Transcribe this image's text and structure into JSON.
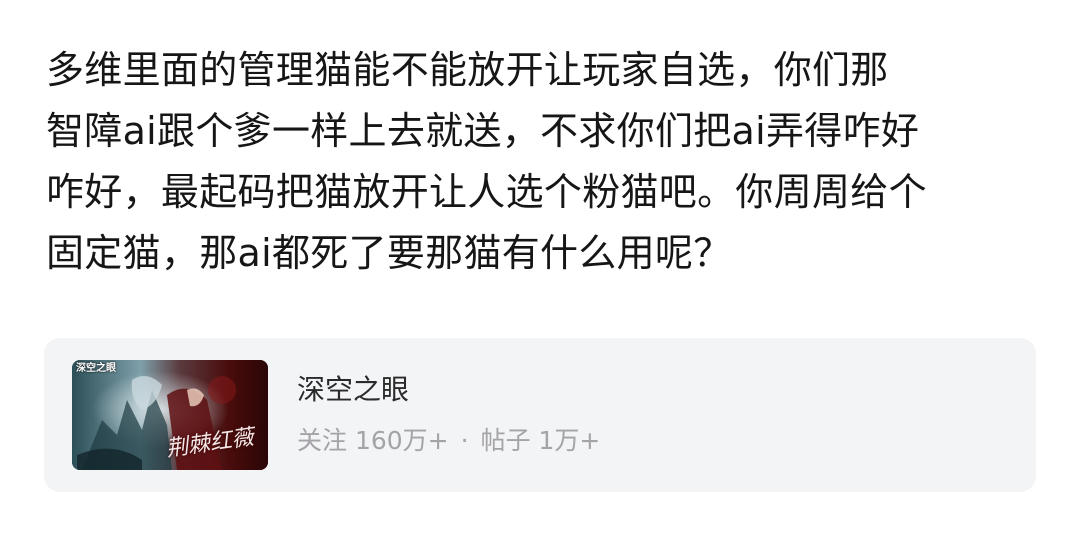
{
  "post": {
    "lines": [
      "多维里面的管理猫能不能放开让玩家自选，你们那",
      "智障ai跟个爹一样上去就送，不求你们把ai弄得咋好",
      "咋好，最起码把猫放开让人选个粉猫吧。你周周给个",
      "固定猫，那ai都死了要那猫有什么用呢？"
    ]
  },
  "forum": {
    "name": "深空之眼",
    "stats": {
      "followers": "关注 160万+",
      "separator": "·",
      "posts": "帖子 1万+"
    },
    "cover": {
      "logo_text": "深空之眼",
      "title_text": "荆棘红薇",
      "colors": {
        "left": "#3e6f7a",
        "mid": "#9fb7c0",
        "right": "#6b1010"
      }
    }
  },
  "colors": {
    "card_bg": "#f3f4f6",
    "text_primary": "#161616",
    "text_secondary": "#a3a3a8"
  }
}
